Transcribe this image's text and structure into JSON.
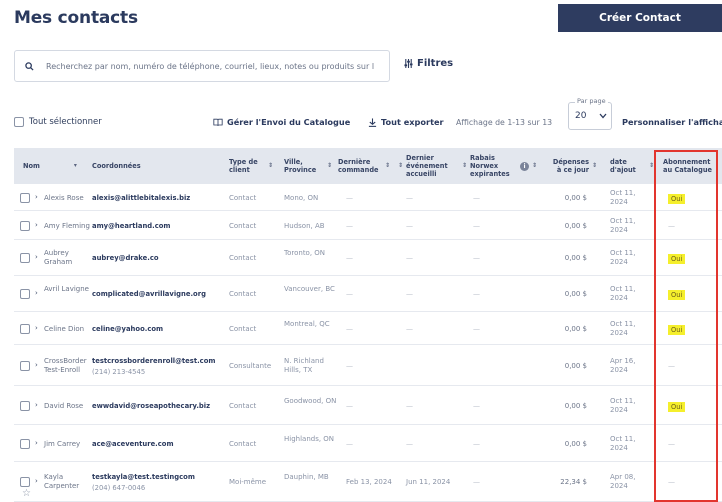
{
  "header": {
    "title": "Mes contacts",
    "create_label": "Créer Contact"
  },
  "search": {
    "placeholder": "Recherchez par nom, numéro de téléphone, courriel, lieux, notes ou produits sur l",
    "filters_label": "Filtres"
  },
  "toolbar": {
    "select_all": "Tout sélectionner",
    "manage_catalog": "Gérer l'Envoi du Catalogue",
    "export_all": "Tout exporter",
    "display_range": "Affichage de 1-13 sur 13",
    "per_page_label": "Par page",
    "per_page_value": "20",
    "personalize": "Personnaliser l'affichage"
  },
  "columns": {
    "name": "Nom",
    "coords": "Coordonnées",
    "type": "Type de client",
    "city": "Ville, Province",
    "last_order": "Dernière commande",
    "last_event": "Dernier événement accueilli",
    "discounts": "Rabais Norwex expirantes",
    "spent": "Dépenses à ce jour",
    "date": "date d'ajout",
    "subscription": "Abonnement au Catalogue"
  },
  "rows": [
    {
      "name": "Alexis Rose",
      "email": "alexis@alittlebitalexis.biz",
      "phone": "",
      "type": "Contact",
      "city": "Mono, ON",
      "last_order": "—",
      "last_event": "—",
      "discounts": "—",
      "spent": "0,00 $",
      "date": "Oct 11, 2024",
      "subscription": "Oui"
    },
    {
      "name": "Amy Fleming",
      "email": "amy@heartland.com",
      "phone": "",
      "type": "Contact",
      "city": "Hudson, AB",
      "last_order": "—",
      "last_event": "—",
      "discounts": "—",
      "spent": "0,00 $",
      "date": "Oct 11, 2024",
      "subscription": "—"
    },
    {
      "name": "Aubrey Graham",
      "email": "aubrey@drake.co",
      "phone": "",
      "type": "Contact",
      "city": "Toronto, ON",
      "last_order": "—",
      "last_event": "—",
      "discounts": "—",
      "spent": "0,00 $",
      "date": "Oct 11, 2024",
      "subscription": "Oui"
    },
    {
      "name": "Avril Lavigne",
      "email": "complicated@avrillavigne.org",
      "phone": "",
      "type": "Contact",
      "city": "Vancouver, BC",
      "last_order": "—",
      "last_event": "—",
      "discounts": "—",
      "spent": "0,00 $",
      "date": "Oct 11, 2024",
      "subscription": "Oui"
    },
    {
      "name": "Celine Dion",
      "email": "celine@yahoo.com",
      "phone": "",
      "type": "Contact",
      "city": "Montreal, QC",
      "last_order": "—",
      "last_event": "—",
      "discounts": "—",
      "spent": "0,00 $",
      "date": "Oct 11, 2024",
      "subscription": "Oui"
    },
    {
      "name": "CrossBorder Test-Enroll",
      "email": "testcrossborderenroll@test.com",
      "phone": "(214) 213-4545",
      "type": "Consultante",
      "city": "N. Richland Hills, TX",
      "last_order": "—",
      "last_event": "",
      "discounts": "",
      "spent": "0,00 $",
      "date": "Apr 16, 2024",
      "subscription": "—"
    },
    {
      "name": "David Rose",
      "email": "ewwdavid@roseapothecary.biz",
      "phone": "",
      "type": "Contact",
      "city": "Goodwood, ON",
      "last_order": "—",
      "last_event": "—",
      "discounts": "—",
      "spent": "0,00 $",
      "date": "Oct 11, 2024",
      "subscription": "Oui"
    },
    {
      "name": "Jim Carrey",
      "email": "ace@aceventure.com",
      "phone": "",
      "type": "Contact",
      "city": "Highlands, ON",
      "last_order": "—",
      "last_event": "—",
      "discounts": "—",
      "spent": "0,00 $",
      "date": "Oct 11, 2024",
      "subscription": "—"
    },
    {
      "name": "Kayla Carpenter",
      "email": "testkayla@test.testingcom",
      "phone": "(204) 647-0046",
      "type": "Moi-même",
      "city": "Dauphin, MB",
      "last_order": "Feb 13, 2024",
      "last_event": "Jun 11, 2024",
      "discounts": "—",
      "spent": "22,34 $",
      "date": "Apr 08, 2024",
      "subscription": "—"
    }
  ]
}
